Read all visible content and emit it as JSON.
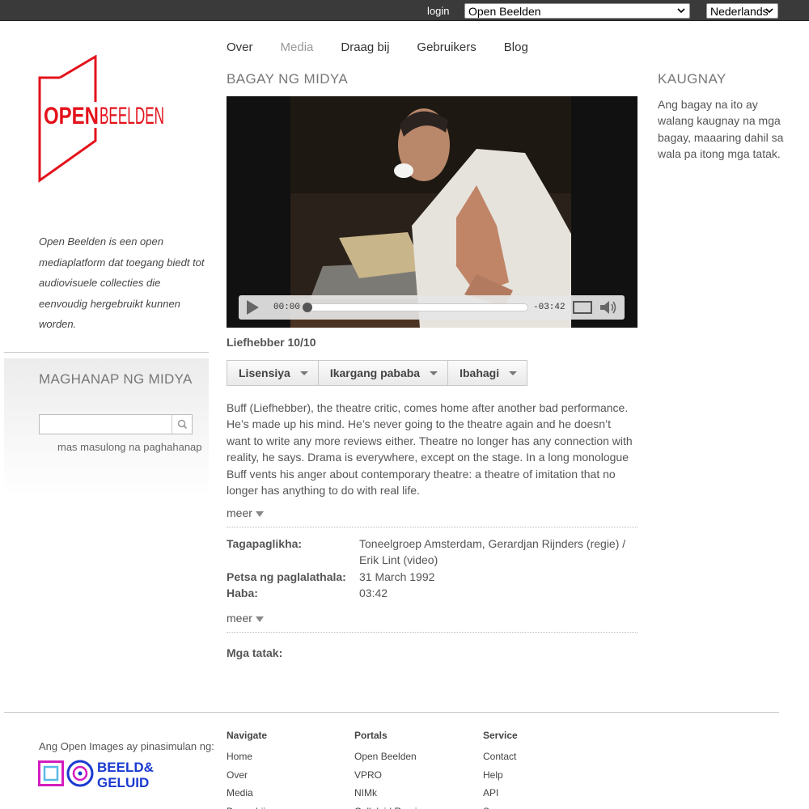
{
  "topbar": {
    "login_label": "login",
    "portal_selected": "Open Beelden",
    "language_selected": "Nederlands"
  },
  "logo": {
    "text_open": "OPEN",
    "text_beelden": "BEELDEN",
    "color": "#e3121b"
  },
  "intro": "Open Beelden is een open mediaplatform dat toegang biedt tot audiovisuele collecties die eenvoudig hergebruikt kunnen worden.",
  "search": {
    "title": "MAGHANAP NG MIDYA",
    "placeholder": "",
    "advanced_label": "mas masulong na paghahanap"
  },
  "nav": {
    "items": [
      "Over",
      "Media",
      "Draag bij",
      "Gebruikers",
      "Blog"
    ],
    "active": "Media"
  },
  "media": {
    "section_title": "BAGAY NG MIDYA",
    "player": {
      "time_current": "00:00",
      "time_remaining": "-03:42",
      "progress": 0
    },
    "rating": "Liefhebber 10/10",
    "buttons": [
      "Lisensiya",
      "Ikargang pababa",
      "Ibahagi"
    ],
    "description": "Buff (Liefhebber), the theatre critic, comes home after another bad performance. He’s made up his mind. He’s never going to the theatre again and he doesn’t want to write any more reviews either. Theatre no longer has any connection with reality, he says. Drama is everywhere, except on the stage. In a long monologue Buff vents his anger about contemporary theatre: a theatre of imitation that no longer has anything to do with real life.",
    "more_label": "meer",
    "meta": {
      "creator_label": "Tagapaglikha:",
      "creator_value": "Toneelgroep Amsterdam, Gerardjan Rijnders (regie) / Erik Lint (video)",
      "date_label": "Petsa ng paglalathala:",
      "date_value": "31 March 1992",
      "duration_label": "Haba:",
      "duration_value": "03:42"
    },
    "tags_label": "Mga tatak:"
  },
  "related": {
    "title": "KAUGNAY",
    "text": "Ang bagay na ito ay walang kaugnay na mga bagay, maaaring dahil sa wala pa itong mga tatak."
  },
  "footer": {
    "initiated_by": "Ang Open Images ay pinasimulan ng:",
    "partner_logo_text": [
      "BEELD&",
      "GELUID"
    ],
    "columns": [
      {
        "heading": "Navigate",
        "links": [
          "Home",
          "Over",
          "Media",
          "Draag bij"
        ]
      },
      {
        "heading": "Portals",
        "links": [
          "Open Beelden",
          "VPRO",
          "NIMk",
          "Celluloid Remix"
        ]
      },
      {
        "heading": "Service",
        "links": [
          "Contact",
          "Help",
          "API",
          "Source"
        ]
      }
    ]
  },
  "colors": {
    "brand_red": "#e3121b",
    "partner_blue": "#1a3ad0",
    "partner_magenta": "#d41dbe"
  }
}
